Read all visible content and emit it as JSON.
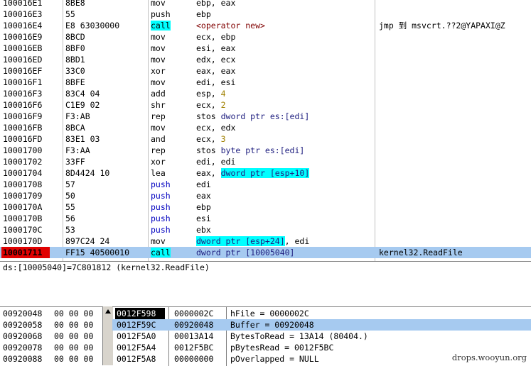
{
  "disasm": {
    "rows": [
      {
        "addr": "100016E1",
        "hex": "8BE8",
        "mn": "mov",
        "ops": [
          {
            "t": "ebp, eax"
          }
        ],
        "cm": ""
      },
      {
        "addr": "100016E3",
        "hex": "55",
        "mn": "push",
        "ops": [
          {
            "t": "ebp"
          }
        ],
        "cm": ""
      },
      {
        "addr": "100016E4",
        "hex": "E8 63030000",
        "mn": "call",
        "mnhl": true,
        "ops": [
          {
            "t": "<operator new>",
            "c": "opnew"
          }
        ],
        "cm": "jmp 到 msvcrt.??2@YAPAXI@Z"
      },
      {
        "addr": "100016E9",
        "hex": "8BCD",
        "mn": "mov",
        "ops": [
          {
            "t": "ecx, ebp"
          }
        ],
        "cm": ""
      },
      {
        "addr": "100016EB",
        "hex": "8BF0",
        "mn": "mov",
        "ops": [
          {
            "t": "esi, eax"
          }
        ],
        "cm": ""
      },
      {
        "addr": "100016ED",
        "hex": "8BD1",
        "mn": "mov",
        "ops": [
          {
            "t": "edx, ecx"
          }
        ],
        "cm": ""
      },
      {
        "addr": "100016EF",
        "hex": "33C0",
        "mn": "xor",
        "ops": [
          {
            "t": "eax, eax"
          }
        ],
        "cm": ""
      },
      {
        "addr": "100016F1",
        "hex": "8BFE",
        "mn": "mov",
        "ops": [
          {
            "t": "edi, esi"
          }
        ],
        "cm": ""
      },
      {
        "addr": "100016F3",
        "hex": "83C4 04",
        "mn": "add",
        "ops": [
          {
            "t": "esp, "
          },
          {
            "t": "4",
            "c": "num"
          }
        ],
        "cm": ""
      },
      {
        "addr": "100016F6",
        "hex": "C1E9 02",
        "mn": "shr",
        "ops": [
          {
            "t": "ecx, "
          },
          {
            "t": "2",
            "c": "num"
          }
        ],
        "cm": ""
      },
      {
        "addr": "100016F9",
        "hex": "F3:AB",
        "mn": "rep",
        "ops": [
          {
            "t": "stos "
          },
          {
            "t": "dword ptr es:[edi]",
            "c": "kw"
          }
        ],
        "cm": ""
      },
      {
        "addr": "100016FB",
        "hex": "8BCA",
        "mn": "mov",
        "ops": [
          {
            "t": "ecx, edx"
          }
        ],
        "cm": ""
      },
      {
        "addr": "100016FD",
        "hex": "83E1 03",
        "mn": "and",
        "ops": [
          {
            "t": "ecx, "
          },
          {
            "t": "3",
            "c": "num"
          }
        ],
        "cm": ""
      },
      {
        "addr": "10001700",
        "hex": "F3:AA",
        "mn": "rep",
        "ops": [
          {
            "t": "stos "
          },
          {
            "t": "byte ptr es:[edi]",
            "c": "kw"
          }
        ],
        "cm": ""
      },
      {
        "addr": "10001702",
        "hex": "33FF",
        "mn": "xor",
        "ops": [
          {
            "t": "edi, edi"
          }
        ],
        "cm": ""
      },
      {
        "addr": "10001704",
        "hex": "8D4424 10",
        "mn": "lea",
        "ops": [
          {
            "t": "eax, "
          },
          {
            "t": "dword ptr [esp+10]",
            "c": "kw hl"
          }
        ],
        "cm": ""
      },
      {
        "addr": "10001708",
        "hex": "57",
        "mn": "push",
        "mnc": "blue",
        "ops": [
          {
            "t": "edi"
          }
        ],
        "cm": ""
      },
      {
        "addr": "10001709",
        "hex": "50",
        "mn": "push",
        "mnc": "blue",
        "ops": [
          {
            "t": "eax"
          }
        ],
        "cm": ""
      },
      {
        "addr": "1000170A",
        "hex": "55",
        "mn": "push",
        "mnc": "blue",
        "ops": [
          {
            "t": "ebp"
          }
        ],
        "cm": ""
      },
      {
        "addr": "1000170B",
        "hex": "56",
        "mn": "push",
        "mnc": "blue",
        "ops": [
          {
            "t": "esi"
          }
        ],
        "cm": ""
      },
      {
        "addr": "1000170C",
        "hex": "53",
        "mn": "push",
        "mnc": "blue",
        "ops": [
          {
            "t": "ebx"
          }
        ],
        "cm": ""
      },
      {
        "addr": "1000170D",
        "hex": "897C24 24",
        "mn": "mov",
        "ops": [
          {
            "t": "dword ptr [esp+24]",
            "c": "kw hl"
          },
          {
            "t": ", edi"
          }
        ],
        "cm": ""
      },
      {
        "addr": "10001711",
        "hex": "FF15 40500010",
        "mn": "call",
        "mnhl": true,
        "ops": [
          {
            "t": "dword ptr [10005040]",
            "c": "kw"
          }
        ],
        "cm": "kernel32.ReadFile",
        "sel": true,
        "eip": true
      }
    ]
  },
  "info": {
    "text": "ds:[10005040]=7C801812 (kernel32.ReadFile)"
  },
  "dump": {
    "rows": [
      {
        "addr": "00920048",
        "bytes": "00 00 00"
      },
      {
        "addr": "00920058",
        "bytes": "00 00 00"
      },
      {
        "addr": "00920068",
        "bytes": "00 00 00"
      },
      {
        "addr": "00920078",
        "bytes": "00 00 00"
      },
      {
        "addr": "00920088",
        "bytes": "00 00 00"
      }
    ]
  },
  "stack": {
    "rows": [
      {
        "addr": "0012F598",
        "val": "0000002C",
        "desc": "hFile = 0000002C",
        "top": true
      },
      {
        "addr": "0012F59C",
        "val": "00920048",
        "desc": "Buffer = 00920048",
        "sel": true
      },
      {
        "addr": "0012F5A0",
        "val": "00013A14",
        "desc": "BytesToRead = 13A14 (80404.)"
      },
      {
        "addr": "0012F5A4",
        "val": "0012F5BC",
        "desc": "pBytesRead = 0012F5BC"
      },
      {
        "addr": "0012F5A8",
        "val": "00000000",
        "desc": "pOverlapped = NULL"
      }
    ]
  },
  "watermark": "drops.wooyun.org",
  "colors": {
    "selection": "#a6caf0",
    "highlight": "#00ffff",
    "eip": "#e00000"
  }
}
